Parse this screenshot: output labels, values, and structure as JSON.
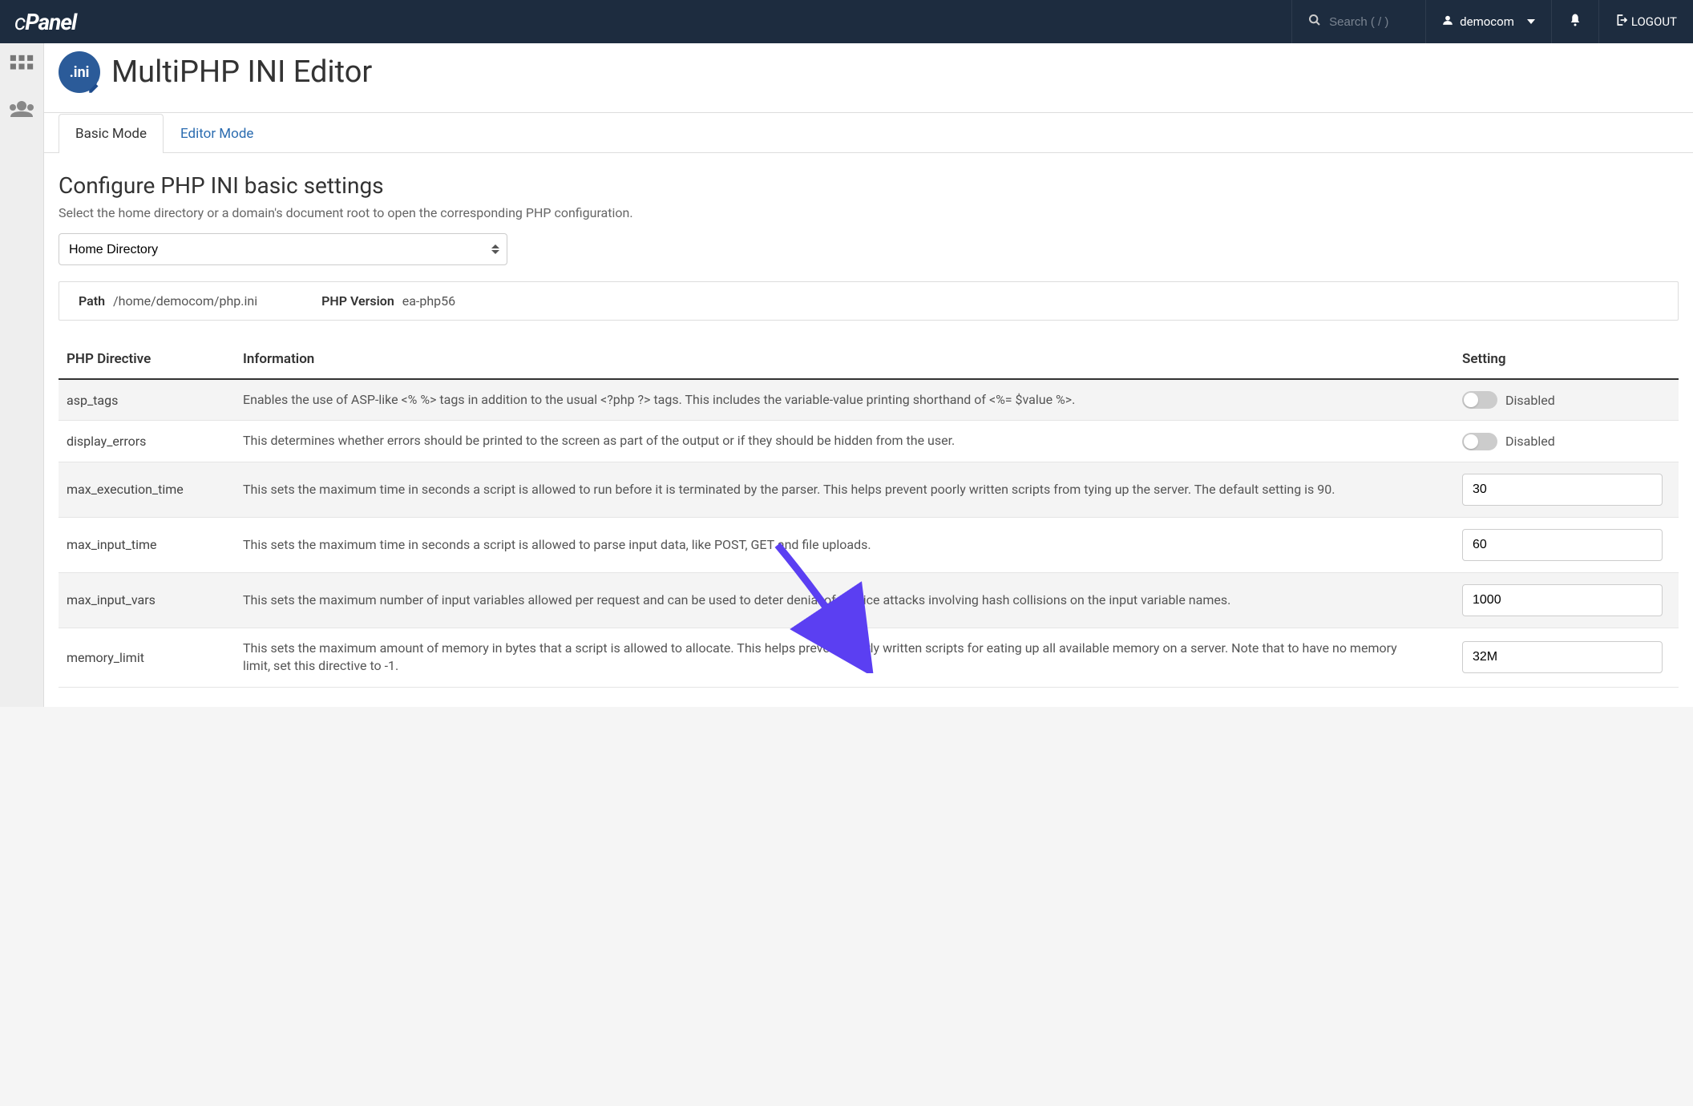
{
  "navbar": {
    "logo_text": "cPanel",
    "search_placeholder": "Search ( / )",
    "username": "democom",
    "logout_label": "LOGOUT"
  },
  "page": {
    "title": "MultiPHP INI Editor",
    "icon_text": ".ini"
  },
  "tabs": [
    {
      "label": "Basic Mode",
      "active": true
    },
    {
      "label": "Editor Mode",
      "active": false
    }
  ],
  "section": {
    "heading": "Configure PHP INI basic settings",
    "description": "Select the home directory or a domain's document root to open the corresponding PHP configuration."
  },
  "select": {
    "value": "Home Directory"
  },
  "info": {
    "path_label": "Path",
    "path_value": "/home/democom/php.ini",
    "version_label": "PHP Version",
    "version_value": "ea-php56"
  },
  "table": {
    "headers": {
      "directive": "PHP Directive",
      "information": "Information",
      "setting": "Setting"
    }
  },
  "rows": [
    {
      "name": "asp_tags",
      "info": "Enables the use of ASP-like <% %> tags in addition to the usual <?php ?> tags. This includes the variable-value printing shorthand of <%= $value %>.",
      "type": "toggle",
      "value": "Disabled"
    },
    {
      "name": "display_errors",
      "info": "This determines whether errors should be printed to the screen as part of the output or if they should be hidden from the user.",
      "type": "toggle",
      "value": "Disabled"
    },
    {
      "name": "max_execution_time",
      "info": "This sets the maximum time in seconds a script is allowed to run before it is terminated by the parser. This helps prevent poorly written scripts from tying up the server. The default setting is 90.",
      "type": "text",
      "value": "30"
    },
    {
      "name": "max_input_time",
      "info": "This sets the maximum time in seconds a script is allowed to parse input data, like POST, GET and file uploads.",
      "type": "text",
      "value": "60"
    },
    {
      "name": "max_input_vars",
      "info": "This sets the maximum number of input variables allowed per request and can be used to deter denial of service attacks involving hash collisions on the input variable names.",
      "type": "text",
      "value": "1000"
    },
    {
      "name": "memory_limit",
      "info": "This sets the maximum amount of memory in bytes that a script is allowed to allocate. This helps prevent poorly written scripts for eating up all available memory on a server. Note that to have no memory limit, set this directive to -1.",
      "type": "text",
      "value": "32M"
    }
  ],
  "annotation": {
    "color": "#5b3ff2"
  }
}
